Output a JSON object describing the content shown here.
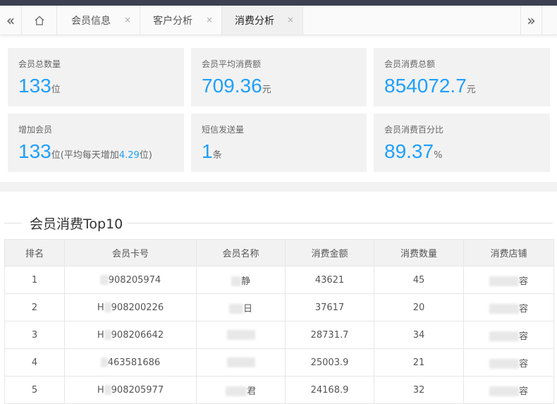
{
  "tabs": {
    "home_icon": "home-icon",
    "items": [
      {
        "label": "会员信息",
        "active": false
      },
      {
        "label": "客户分析",
        "active": false
      },
      {
        "label": "消费分析",
        "active": true
      }
    ],
    "close_glyph": "×",
    "nav_left": "«",
    "nav_right": "»"
  },
  "stats": [
    {
      "label": "会员总数量",
      "value": "133",
      "unit": "位"
    },
    {
      "label": "会员平均消费额",
      "value": "709.36",
      "unit": "元"
    },
    {
      "label": "会员消费总额",
      "value": "854072.7",
      "unit": "元"
    },
    {
      "label": "增加会员",
      "value": "133",
      "unit": "位",
      "extra_prefix": "(平均每天增加",
      "extra_value": "4.29",
      "extra_suffix": "位)"
    },
    {
      "label": "短信发送量",
      "value": "1",
      "unit": "条"
    },
    {
      "label": "会员消费百分比",
      "value": "89.37",
      "unit": "%"
    }
  ],
  "section": {
    "title": "会员消费Top10"
  },
  "table": {
    "headers": [
      "排名",
      "会员卡号",
      "会员名称",
      "消费金额",
      "消费数量",
      "消费店铺"
    ],
    "rows": [
      {
        "rank": "1",
        "card": "908205974",
        "name": "静",
        "amount": "43621",
        "qty": "45",
        "store": "容"
      },
      {
        "rank": "2",
        "card": "908200226",
        "name": "日",
        "amount": "37617",
        "qty": "20",
        "store": "容"
      },
      {
        "rank": "3",
        "card": "908206642",
        "name": "",
        "amount": "28731.7",
        "qty": "34",
        "store": "容"
      },
      {
        "rank": "4",
        "card": "463581686",
        "name": "",
        "amount": "25003.9",
        "qty": "21",
        "store": "容"
      },
      {
        "rank": "5",
        "card": "908205977",
        "name": "君",
        "amount": "24168.9",
        "qty": "32",
        "store": "容"
      }
    ],
    "card_prefixes": [
      "",
      "H",
      "H",
      "",
      "H"
    ]
  }
}
